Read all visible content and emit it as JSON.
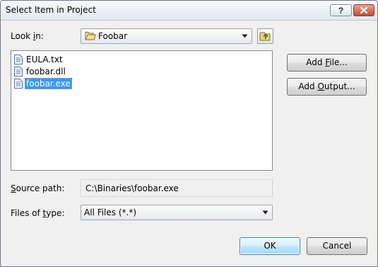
{
  "window": {
    "title": "Select Item in Project"
  },
  "title_buttons": {
    "help_label": "?",
    "close_label": "×"
  },
  "look_in": {
    "label_prefix": "Look ",
    "label_accel": "i",
    "label_suffix": "n:",
    "folder_icon": "open-folder-icon",
    "value": "Foobar"
  },
  "files": [
    {
      "name": "EULA.txt",
      "icon": "file-icon",
      "selected": false
    },
    {
      "name": "foobar.dll",
      "icon": "file-icon",
      "selected": false
    },
    {
      "name": "foobar.exe",
      "icon": "file-icon",
      "selected": true
    }
  ],
  "add_file": {
    "prefix": "Add ",
    "accel": "F",
    "suffix": "ile..."
  },
  "add_output": {
    "prefix": "Add ",
    "accel": "O",
    "suffix": "utput..."
  },
  "source_path": {
    "label_accel": "S",
    "label_rest": "ource path:",
    "value": "C:\\Binaries\\foobar.exe"
  },
  "files_of_type": {
    "label_prefix": "Files of ",
    "label_accel": "t",
    "label_suffix": "ype:",
    "value": "All Files (*.*)"
  },
  "buttons": {
    "ok": "OK",
    "cancel": "Cancel"
  }
}
